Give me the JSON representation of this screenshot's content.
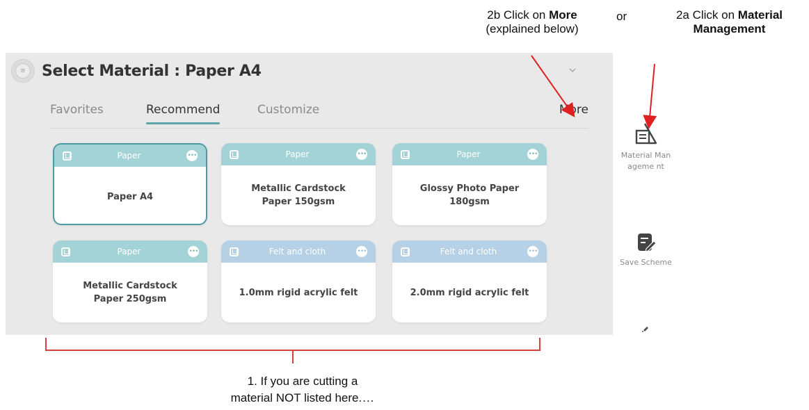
{
  "annotations": {
    "more_prefix": "2b Click on ",
    "more_bold": "More",
    "more_line2": "(explained below)",
    "or": "or",
    "material_prefix": "2a Click on ",
    "material_bold_1": "Material",
    "material_bold_2": "Management",
    "bottom_line1": "1.  If you are cutting a",
    "bottom_line2": "material  NOT listed here",
    "bottom_dots": "....",
    "arrow_color": "#e02020",
    "bracket_color": "#d94040"
  },
  "panel": {
    "title": "Select Material : Paper A4",
    "collapse_icon": "chevron-down-icon"
  },
  "tabs": {
    "items": [
      {
        "label": "Favorites"
      },
      {
        "label": "Recommend"
      },
      {
        "label": "Customize"
      }
    ],
    "active": "Recommend",
    "more_label": "More"
  },
  "cards": [
    {
      "category": "Paper",
      "name": "Paper A4",
      "kind": "paper",
      "selected": true
    },
    {
      "category": "Paper",
      "name": "Metallic Cardstock\nPaper 150gsm",
      "kind": "paper",
      "selected": false
    },
    {
      "category": "Paper",
      "name": "Glossy Photo Paper\n180gsm",
      "kind": "paper",
      "selected": false
    },
    {
      "category": "Paper",
      "name": "Metallic Cardstock\nPaper 250gsm",
      "kind": "paper",
      "selected": false
    },
    {
      "category": "Felt and cloth",
      "name": "1.0mm rigid acrylic felt",
      "kind": "felt",
      "selected": false
    },
    {
      "category": "Felt and cloth",
      "name": "2.0mm rigid acrylic felt",
      "kind": "felt",
      "selected": false
    }
  ],
  "sidebar": {
    "material_management_label": "Material Manageme nt",
    "save_scheme_label": "Save Scheme"
  },
  "colors": {
    "accent": "#5fa4aa",
    "paper_header": "#a3d3d6",
    "felt_header": "#b6d0e6",
    "panel_bg": "#e9e9e9"
  }
}
